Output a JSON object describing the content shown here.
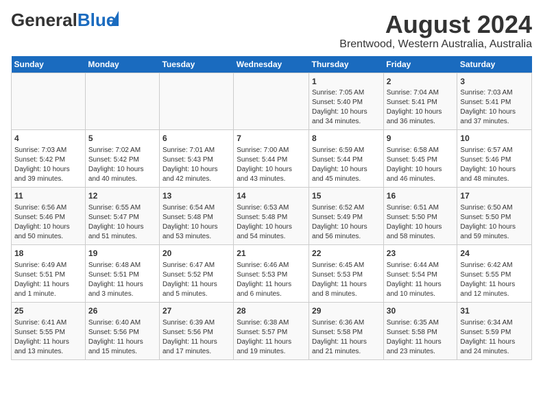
{
  "header": {
    "logo_general": "General",
    "logo_blue": "Blue",
    "title": "August 2024",
    "subtitle": "Brentwood, Western Australia, Australia"
  },
  "days_of_week": [
    "Sunday",
    "Monday",
    "Tuesday",
    "Wednesday",
    "Thursday",
    "Friday",
    "Saturday"
  ],
  "weeks": [
    [
      {
        "day": "",
        "text": ""
      },
      {
        "day": "",
        "text": ""
      },
      {
        "day": "",
        "text": ""
      },
      {
        "day": "",
        "text": ""
      },
      {
        "day": "1",
        "text": "Sunrise: 7:05 AM\nSunset: 5:40 PM\nDaylight: 10 hours\nand 34 minutes."
      },
      {
        "day": "2",
        "text": "Sunrise: 7:04 AM\nSunset: 5:41 PM\nDaylight: 10 hours\nand 36 minutes."
      },
      {
        "day": "3",
        "text": "Sunrise: 7:03 AM\nSunset: 5:41 PM\nDaylight: 10 hours\nand 37 minutes."
      }
    ],
    [
      {
        "day": "4",
        "text": "Sunrise: 7:03 AM\nSunset: 5:42 PM\nDaylight: 10 hours\nand 39 minutes."
      },
      {
        "day": "5",
        "text": "Sunrise: 7:02 AM\nSunset: 5:42 PM\nDaylight: 10 hours\nand 40 minutes."
      },
      {
        "day": "6",
        "text": "Sunrise: 7:01 AM\nSunset: 5:43 PM\nDaylight: 10 hours\nand 42 minutes."
      },
      {
        "day": "7",
        "text": "Sunrise: 7:00 AM\nSunset: 5:44 PM\nDaylight: 10 hours\nand 43 minutes."
      },
      {
        "day": "8",
        "text": "Sunrise: 6:59 AM\nSunset: 5:44 PM\nDaylight: 10 hours\nand 45 minutes."
      },
      {
        "day": "9",
        "text": "Sunrise: 6:58 AM\nSunset: 5:45 PM\nDaylight: 10 hours\nand 46 minutes."
      },
      {
        "day": "10",
        "text": "Sunrise: 6:57 AM\nSunset: 5:46 PM\nDaylight: 10 hours\nand 48 minutes."
      }
    ],
    [
      {
        "day": "11",
        "text": "Sunrise: 6:56 AM\nSunset: 5:46 PM\nDaylight: 10 hours\nand 50 minutes."
      },
      {
        "day": "12",
        "text": "Sunrise: 6:55 AM\nSunset: 5:47 PM\nDaylight: 10 hours\nand 51 minutes."
      },
      {
        "day": "13",
        "text": "Sunrise: 6:54 AM\nSunset: 5:48 PM\nDaylight: 10 hours\nand 53 minutes."
      },
      {
        "day": "14",
        "text": "Sunrise: 6:53 AM\nSunset: 5:48 PM\nDaylight: 10 hours\nand 54 minutes."
      },
      {
        "day": "15",
        "text": "Sunrise: 6:52 AM\nSunset: 5:49 PM\nDaylight: 10 hours\nand 56 minutes."
      },
      {
        "day": "16",
        "text": "Sunrise: 6:51 AM\nSunset: 5:50 PM\nDaylight: 10 hours\nand 58 minutes."
      },
      {
        "day": "17",
        "text": "Sunrise: 6:50 AM\nSunset: 5:50 PM\nDaylight: 10 hours\nand 59 minutes."
      }
    ],
    [
      {
        "day": "18",
        "text": "Sunrise: 6:49 AM\nSunset: 5:51 PM\nDaylight: 11 hours\nand 1 minute."
      },
      {
        "day": "19",
        "text": "Sunrise: 6:48 AM\nSunset: 5:51 PM\nDaylight: 11 hours\nand 3 minutes."
      },
      {
        "day": "20",
        "text": "Sunrise: 6:47 AM\nSunset: 5:52 PM\nDaylight: 11 hours\nand 5 minutes."
      },
      {
        "day": "21",
        "text": "Sunrise: 6:46 AM\nSunset: 5:53 PM\nDaylight: 11 hours\nand 6 minutes."
      },
      {
        "day": "22",
        "text": "Sunrise: 6:45 AM\nSunset: 5:53 PM\nDaylight: 11 hours\nand 8 minutes."
      },
      {
        "day": "23",
        "text": "Sunrise: 6:44 AM\nSunset: 5:54 PM\nDaylight: 11 hours\nand 10 minutes."
      },
      {
        "day": "24",
        "text": "Sunrise: 6:42 AM\nSunset: 5:55 PM\nDaylight: 11 hours\nand 12 minutes."
      }
    ],
    [
      {
        "day": "25",
        "text": "Sunrise: 6:41 AM\nSunset: 5:55 PM\nDaylight: 11 hours\nand 13 minutes."
      },
      {
        "day": "26",
        "text": "Sunrise: 6:40 AM\nSunset: 5:56 PM\nDaylight: 11 hours\nand 15 minutes."
      },
      {
        "day": "27",
        "text": "Sunrise: 6:39 AM\nSunset: 5:56 PM\nDaylight: 11 hours\nand 17 minutes."
      },
      {
        "day": "28",
        "text": "Sunrise: 6:38 AM\nSunset: 5:57 PM\nDaylight: 11 hours\nand 19 minutes."
      },
      {
        "day": "29",
        "text": "Sunrise: 6:36 AM\nSunset: 5:58 PM\nDaylight: 11 hours\nand 21 minutes."
      },
      {
        "day": "30",
        "text": "Sunrise: 6:35 AM\nSunset: 5:58 PM\nDaylight: 11 hours\nand 23 minutes."
      },
      {
        "day": "31",
        "text": "Sunrise: 6:34 AM\nSunset: 5:59 PM\nDaylight: 11 hours\nand 24 minutes."
      }
    ]
  ]
}
